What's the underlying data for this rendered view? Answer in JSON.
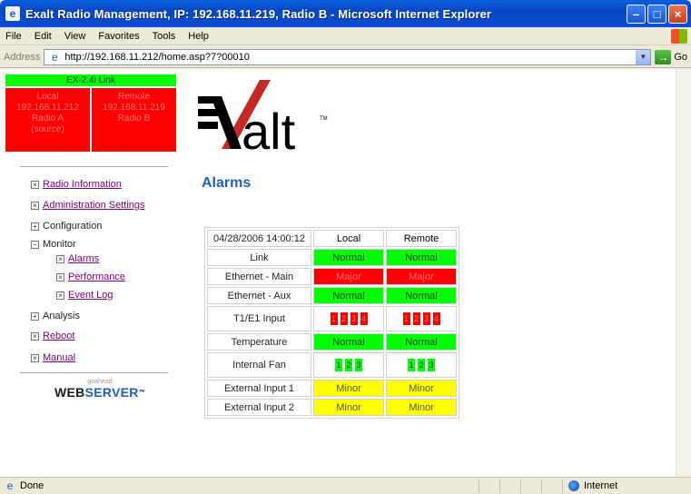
{
  "window": {
    "title": "Exalt Radio Management, IP: 192.168.11.219, Radio B - Microsoft Internet Explorer"
  },
  "menu": [
    "File",
    "Edit",
    "View",
    "Favorites",
    "Tools",
    "Help"
  ],
  "address": {
    "label": "Address",
    "url": "http://192.168.11.212/home.asp?7?00010",
    "go_label": "Go"
  },
  "link_status": {
    "label": "EX-2.4i Link",
    "color": "#00ff00"
  },
  "radios": {
    "local": [
      "Local",
      "192.168.11.212",
      "Radio A",
      "(source)"
    ],
    "remote": [
      "Remote",
      "192.168.11.219",
      "Radio B"
    ]
  },
  "nav": {
    "radio_information": "Radio Information",
    "administration_settings": "Administration Settings",
    "configuration": "Configuration",
    "monitor": "Monitor",
    "alarms": "Alarms",
    "performance": "Performance",
    "event_log": "Event Log",
    "analysis": "Analysis",
    "reboot": "Reboot",
    "manual": "Manual"
  },
  "badge": {
    "small": "goahead",
    "web": "WEB",
    "server": "SERVER",
    "tm": "™"
  },
  "logo": {
    "text": "alt",
    "tm": "TM"
  },
  "page_title": "Alarms",
  "alarms_table": {
    "timestamp": "04/28/2006 14:00:12",
    "col_local": "Local",
    "col_remote": "Remote",
    "rows": [
      {
        "label": "Link",
        "local": "Normal",
        "remote": "Normal"
      },
      {
        "label": "Ethernet - Main",
        "local": "Major",
        "remote": "Major"
      },
      {
        "label": "Ethernet - Aux",
        "local": "Normal",
        "remote": "Normal"
      },
      {
        "label": "T1/E1 Input",
        "local": [
          "1",
          "2",
          "3",
          "4"
        ],
        "remote": [
          "1",
          "2",
          "3",
          "4"
        ]
      },
      {
        "label": "Temperature",
        "local": "Normal",
        "remote": "Normal"
      },
      {
        "label": "Internal Fan",
        "local": [
          "1",
          "2",
          "3"
        ],
        "remote": [
          "1",
          "2",
          "3"
        ]
      },
      {
        "label": "External Input 1",
        "local": "Minor",
        "remote": "Minor"
      },
      {
        "label": "External Input 2",
        "local": "Minor",
        "remote": "Minor"
      }
    ]
  },
  "status": {
    "text": "Done",
    "zone": "Internet"
  },
  "colors": {
    "normal": "#00ff00",
    "major": "#ff0000",
    "minor": "#ffff00",
    "title_blue": "#1f62b3"
  }
}
